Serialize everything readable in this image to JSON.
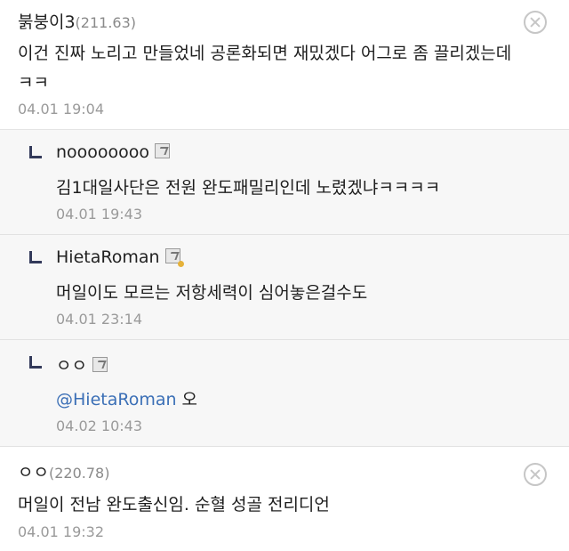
{
  "comments": [
    {
      "author": "붉붕이3",
      "ip": "(211.63)",
      "text_line1": "이건 진짜 노리고 만들었네 공론화되면 재밌겠다 어그로 좀 끌리겠는데",
      "text_line2": "ㅋㅋ",
      "timestamp": "04.01 19:04",
      "delete_icon": "close-circle-icon"
    },
    {
      "author": "ㅇㅇ",
      "ip": "(220.78)",
      "text": "머일이 전남 완도출신임. 순혈 성골 전리디언",
      "timestamp": "04.01 19:32",
      "delete_icon": "close-circle-icon"
    }
  ],
  "replies": [
    {
      "author": "noooooooo",
      "text": "김1대일사단은 전원 완도패밀리인데 노렸겠냐ㅋㅋㅋㅋ",
      "timestamp": "04.01 19:43",
      "icon": "fixed-id-icon"
    },
    {
      "author": "HietaRoman",
      "text": "머일이도 모르는 저항세력이 심어놓은걸수도",
      "timestamp": "04.01 23:14",
      "icon": "fixed-id-gold-icon"
    },
    {
      "author": "ㅇㅇ",
      "mention": "@HietaRoman",
      "text": " 오",
      "timestamp": "04.02 10:43",
      "icon": "fixed-id-icon"
    }
  ]
}
